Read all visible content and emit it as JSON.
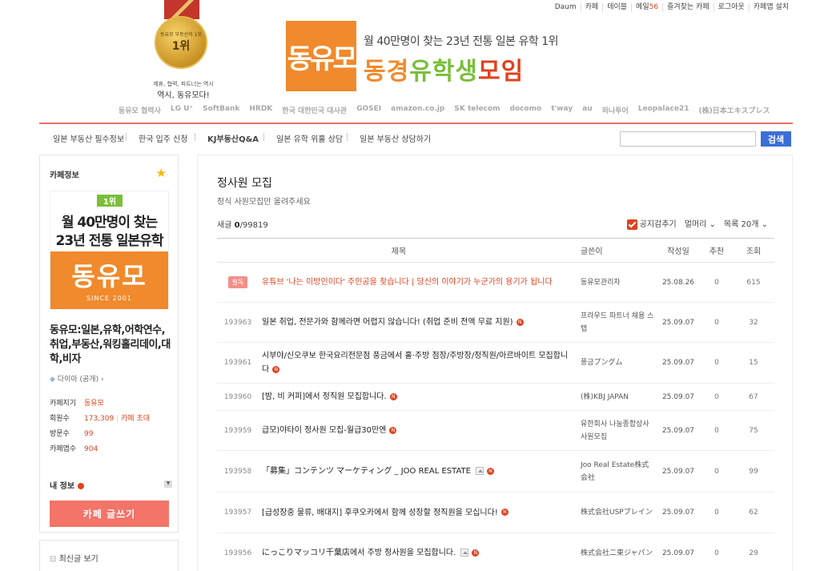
{
  "top_links": [
    "Daum",
    "카페",
    "테이블",
    "메일",
    "즐겨찾는 카페",
    "로그아웃",
    "카페앱 설치"
  ],
  "mail_count": "56",
  "header": {
    "medal_small": "동유모 부동산의 1위",
    "medal_rank": "1위",
    "caption_small": "제휴, 협력, 파트너는 역시",
    "caption": "역시, 동유모다!",
    "logo": "동유모",
    "tagline": "월 40만명이 찾는 23년 전통 일본 유학 1위",
    "brand_1": "동경",
    "brand_2": "유학생",
    "brand_3": "모임",
    "partners": [
      "동유모 협력사",
      "LG U⁺",
      "SoftBank",
      "HRDK",
      "한국 대한민국 대사관",
      "GOSEI",
      "amazon.co.jp",
      "SK telecom",
      "docomo",
      "t'way",
      "au",
      "하나투어",
      "Leopalace21",
      "(株)日本エキスプレス"
    ]
  },
  "nav": {
    "items": [
      "일본 부동산 필수정보",
      "한국 입주 신청",
      "KJ부동산Q&A",
      "일본 유학 위홀 상담",
      "일본 부동산 상담하기"
    ],
    "search_placeholder": "",
    "search_button": "검색"
  },
  "sidebar": {
    "header": "카페정보",
    "banner_rank": "1위",
    "banner_line1": "월 40만명이 찾는",
    "banner_line2": "23년 전통 일본유학",
    "banner_logo": "동유모",
    "banner_since": "SINCE 2001",
    "cafe_name": "동유모:일본,유학,어학연수,취업,부동산,워킹홀리데이,대학,비자",
    "grade": "다이아 (공개)",
    "info_labels": [
      "카페지기",
      "회원수",
      "방문수",
      "카페앱수"
    ],
    "manager": "동유모",
    "members": "173,309",
    "invite": "카페 초대",
    "visits": "99",
    "app_users": "904",
    "my_info": "내 정보",
    "write_button": "카페 글쓰기",
    "recent": "최신글 보기"
  },
  "board": {
    "title": "정사원 모집",
    "description": "정식 사원모집만 올려주세요",
    "new_label": "새글",
    "new_count": "0",
    "total_count": "/99819",
    "hide_notice": "공지감추기",
    "view_mode": "멀머리",
    "per_page": "목록 20개",
    "columns": [
      "제목",
      "글쓴이",
      "작성일",
      "추천",
      "조회"
    ],
    "notice": {
      "badge": "필독",
      "subject": "유튜브 '나는 이방인이다' 주인공을 찾습니다 | 당신의 이야기가 누군가의 용기가 됩니다",
      "author": "동유모관리자",
      "date": "25.08.26",
      "rec": "0",
      "views": "615"
    },
    "rows": [
      {
        "num": "193963",
        "subject": "일본 취업, 전문가와 함께라면 어렵지 않습니다! (취업 준비 전액 무료 지원)",
        "author": "프라우드 파트너 채용 스텝",
        "date": "25.09.07",
        "rec": "0",
        "views": "32"
      },
      {
        "num": "193961",
        "subject": "시부야/신오쿠보 한국요리전문점 풍금에서 홀·주방 점장/주방장/정직원/아르바이트 모집합니다",
        "author": "풍금プングム",
        "date": "25.09.07",
        "rec": "0",
        "views": "15"
      },
      {
        "num": "193960",
        "subject": "[밤, 비 커피]에서 정직원 모집합니다.",
        "author": "(株)KBJ JAPAN",
        "date": "25.09.07",
        "rec": "0",
        "views": "67"
      },
      {
        "num": "193959",
        "subject": "급모)야타이 정사원 모집-월급30만엔",
        "author": "유한회사 나눔종합상사 사원모집",
        "date": "25.09.07",
        "rec": "0",
        "views": "75"
      },
      {
        "num": "193958",
        "subject": "「募集」コンテンツ マーケティング _ JOO REAL ESTATE",
        "author": "Joo Real Estate株式会社",
        "date": "25.09.07",
        "rec": "0",
        "views": "99"
      },
      {
        "num": "193957",
        "subject": "[급성장중 물류, 배대지] 후쿠오카에서 함께 성장할 정직원을 모십니다!",
        "author": "株式会社USPプレイン",
        "date": "25.09.07",
        "rec": "0",
        "views": "62"
      },
      {
        "num": "193956",
        "subject": "にっこりマッコリ千葉店에서 주방 정사원을 모집합니다.",
        "author": "株式会社二東ジャパン",
        "date": "25.09.07",
        "rec": "0",
        "views": "29"
      }
    ]
  }
}
